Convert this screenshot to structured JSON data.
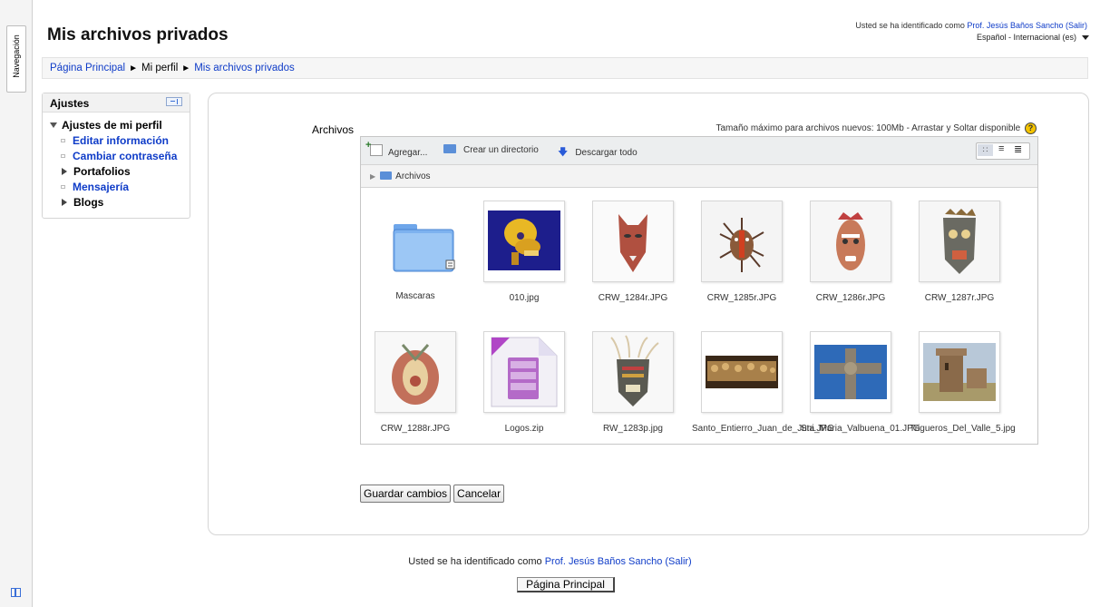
{
  "nav": {
    "tab_label": "Navegación"
  },
  "page": {
    "title": "Mis archivos privados"
  },
  "login_top": {
    "prefix": "Usted se ha identificado como ",
    "user": "Prof. Jesús Baños Sancho",
    "logout": "(Salir)"
  },
  "language": {
    "selected": "Español - Internacional (es)"
  },
  "breadcrumb": {
    "home": "Página Principal",
    "sep": "►",
    "profile": "Mi perfil",
    "current": "Mis archivos privados"
  },
  "settings_block": {
    "title": "Ajustes",
    "section": "Ajustes de mi perfil",
    "items": [
      "Editar información",
      "Cambiar contraseña",
      "Portafolios",
      "Mensajería",
      "Blogs"
    ]
  },
  "form": {
    "label": "Archivos",
    "max_size": "Tamaño máximo para archivos nuevos: 100Mb - Arrastar y Soltar disponible",
    "help_icon": "?"
  },
  "filemanager": {
    "toolbar": {
      "add": "Agregar...",
      "mkdir": "Crear un directorio",
      "download": "Descargar todo"
    },
    "path": "Archivos",
    "files": [
      {
        "name": "Mascaras",
        "type": "folder"
      },
      {
        "name": "010.jpg",
        "type": "skull"
      },
      {
        "name": "CRW_1284r.JPG",
        "type": "mask1"
      },
      {
        "name": "CRW_1285r.JPG",
        "type": "mask2"
      },
      {
        "name": "CRW_1286r.JPG",
        "type": "mask3"
      },
      {
        "name": "CRW_1287r.JPG",
        "type": "mask4"
      },
      {
        "name": "CRW_1288r.JPG",
        "type": "mask5"
      },
      {
        "name": "Logos.zip",
        "type": "zip"
      },
      {
        "name": "RW_1283p.jpg",
        "type": "mask6"
      },
      {
        "name": "Santo_Entierro_Juan_de_Juni.JPG",
        "type": "sculpture"
      },
      {
        "name": "Sta_Maria_Valbuena_01.JPG",
        "type": "cross"
      },
      {
        "name": "Trigueros_Del_Valle_5.jpg",
        "type": "castle"
      }
    ]
  },
  "buttons": {
    "save": "Guardar cambios",
    "cancel": "Cancelar"
  },
  "footer": {
    "prefix": "Usted se ha identificado como ",
    "user": "Prof. Jesús Baños Sancho",
    "logout": "(Salir)",
    "home_button": "Página Principal"
  }
}
